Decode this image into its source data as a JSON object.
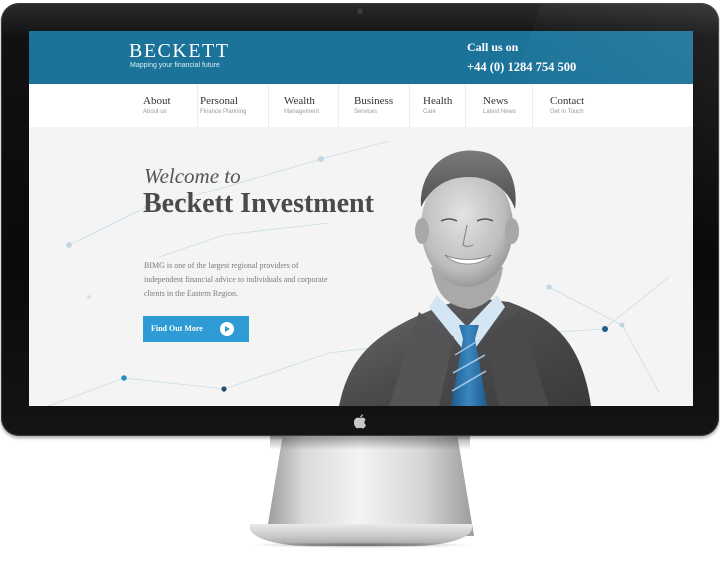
{
  "brand": {
    "name": "BECKETT",
    "tagline": "Mapping your financial future"
  },
  "contact": {
    "label": "Call us on",
    "phone": "+44 (0) 1284 754 500"
  },
  "nav": [
    {
      "title": "About",
      "sub": "About us"
    },
    {
      "title": "Personal",
      "sub": "Finance Planning"
    },
    {
      "title": "Wealth",
      "sub": "Management"
    },
    {
      "title": "Business",
      "sub": "Services"
    },
    {
      "title": "Health",
      "sub": "Care"
    },
    {
      "title": "News",
      "sub": "Latest News"
    },
    {
      "title": "Contact",
      "sub": "Get in Touch"
    }
  ],
  "hero": {
    "welcome": "Welcome to",
    "headline": "Beckett Investment",
    "blurb": "BIMG is one of the largest regional providers of independent financial advice to individuals and corporate clients in the Eastern Region.",
    "cta": "Find Out More"
  },
  "colors": {
    "header": "#1c7399",
    "cta": "#2e9bd4",
    "monitor": "#0f0f10"
  },
  "icons": {
    "camera": "camera-icon",
    "apple": "apple-logo-icon",
    "cta_arrow": "arrow-right-icon"
  }
}
